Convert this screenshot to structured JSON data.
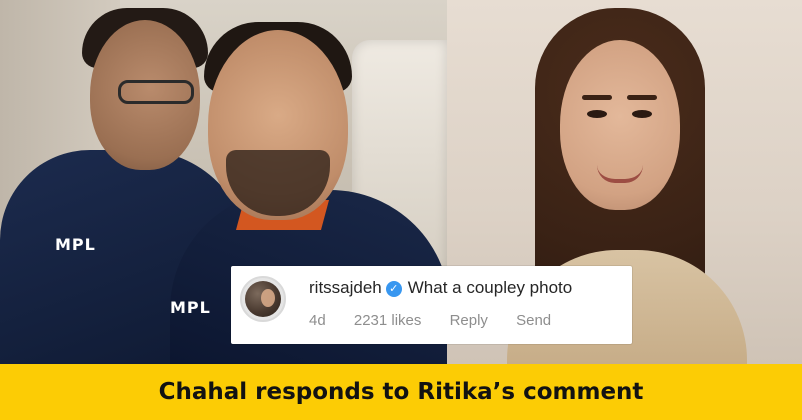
{
  "photos": {
    "left_jersey_logo_a": "MPL",
    "left_jersey_logo_b": "MPL"
  },
  "comment": {
    "username": "ritssajdeh",
    "text": "What a coupley photo",
    "verified_icon": "verified-badge-icon",
    "time_ago": "4d",
    "likes": "2231 likes",
    "reply_label": "Reply",
    "send_label": "Send",
    "colors": {
      "verified": "#3897f0",
      "meta_text": "#8e8e8e",
      "text": "#262626"
    }
  },
  "caption": {
    "text": "Chahal responds to Ritika’s comment",
    "background": "#fccc05"
  }
}
